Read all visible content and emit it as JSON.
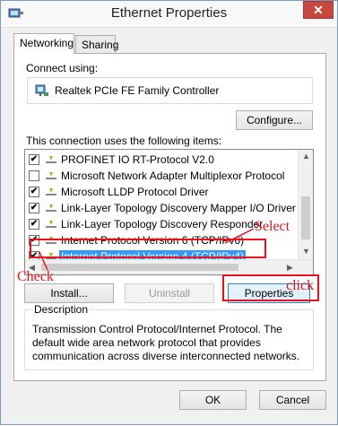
{
  "window": {
    "title": "Ethernet Properties",
    "close_glyph": "✕"
  },
  "tabs": [
    {
      "label": "Networking"
    },
    {
      "label": "Sharing"
    }
  ],
  "connect_using": {
    "label": "Connect using:",
    "adapter": "Realtek PCIe FE Family Controller",
    "configure_button": "Configure..."
  },
  "items_label": "This connection uses the following items:",
  "items": [
    {
      "checked": true,
      "label": "PROFINET IO RT-Protocol V2.0"
    },
    {
      "checked": false,
      "label": "Microsoft Network Adapter Multiplexor Protocol"
    },
    {
      "checked": true,
      "label": "Microsoft LLDP Protocol Driver"
    },
    {
      "checked": true,
      "label": "Link-Layer Topology Discovery Mapper I/O Driver"
    },
    {
      "checked": true,
      "label": "Link-Layer Topology Discovery Responder"
    },
    {
      "checked": true,
      "label": "Internet Protocol Version 6 (TCP/IPv6)"
    },
    {
      "checked": true,
      "label": "Internet Protocol Version 4 (TCP/IPv4)",
      "selected": true
    }
  ],
  "buttons": {
    "install": "Install...",
    "uninstall": "Uninstall",
    "properties": "Properties"
  },
  "description": {
    "legend": "Description",
    "text": "Transmission Control Protocol/Internet Protocol. The default wide area network protocol that provides communication across diverse interconnected networks."
  },
  "footer": {
    "ok": "OK",
    "cancel": "Cancel"
  },
  "annotations": {
    "select": "Select",
    "check": "Check",
    "click": "click"
  },
  "colors": {
    "annotation": "#e8111b",
    "selection": "#3399ff"
  }
}
